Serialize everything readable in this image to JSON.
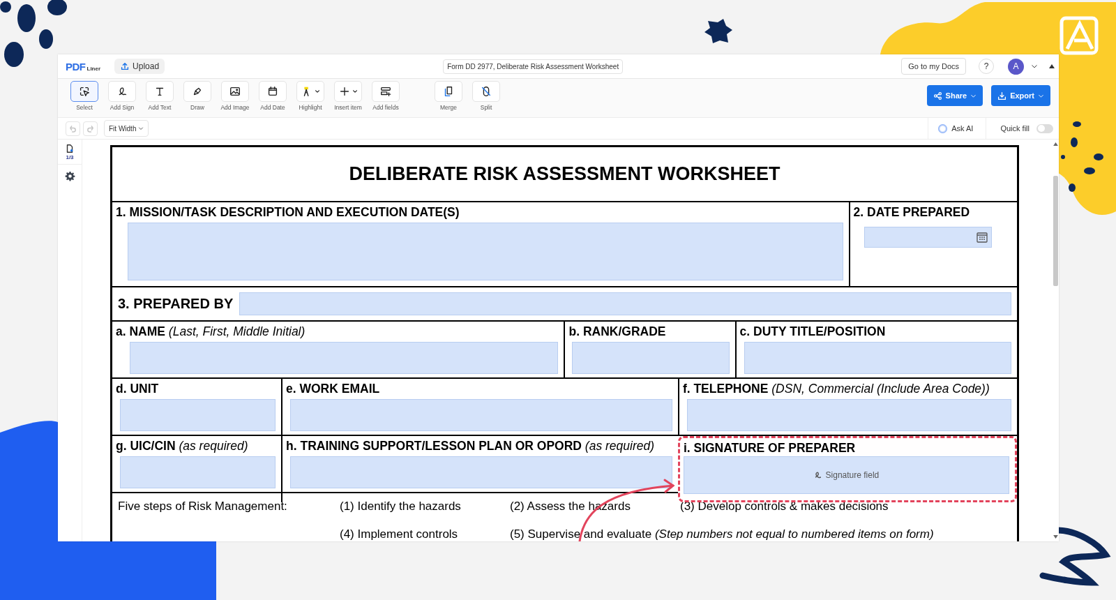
{
  "header": {
    "logo_main": "PDF",
    "logo_sub": "Liner",
    "upload": "Upload",
    "document_title": "Form DD 2977, Deliberate Risk Assessment Worksheet",
    "docs_button": "Go to my Docs",
    "help": "?",
    "avatar": "A"
  },
  "toolbar": {
    "tools": [
      {
        "label": "Select",
        "selected": true,
        "dropdown": false
      },
      {
        "label": "Add Sign",
        "selected": false,
        "dropdown": false
      },
      {
        "label": "Add Text",
        "selected": false,
        "dropdown": false
      },
      {
        "label": "Draw",
        "selected": false,
        "dropdown": false
      },
      {
        "label": "Add Image",
        "selected": false,
        "dropdown": false
      },
      {
        "label": "Add Date",
        "selected": false,
        "dropdown": false
      },
      {
        "label": "Highlight",
        "selected": false,
        "dropdown": true
      },
      {
        "label": "Insert item",
        "selected": false,
        "dropdown": true
      },
      {
        "label": "Add fields",
        "selected": false,
        "dropdown": false
      }
    ],
    "page_tools": [
      {
        "label": "Merge"
      },
      {
        "label": "Split"
      }
    ],
    "share": "Share",
    "export": "Export"
  },
  "subbar": {
    "undo": {
      "disabled": true
    },
    "redo": {
      "disabled": true
    },
    "zoom": "Fit Width",
    "ask_ai": "Ask AI",
    "quick_fill": {
      "label": "Quick fill",
      "on": false
    }
  },
  "sidebar": {
    "page_count": "1/3"
  },
  "form": {
    "title": "DELIBERATE RISK ASSESSMENT WORKSHEET",
    "mission": {
      "label": "1. MISSION/TASK DESCRIPTION AND EXECUTION DATE(S)"
    },
    "date": {
      "label": "2. DATE PREPARED"
    },
    "prepared_by": {
      "label": "3. PREPARED BY"
    },
    "rows": [
      {
        "cells": [
          {
            "label": "a. NAME",
            "note": "(Last, First, Middle Initial)",
            "kind": "text",
            "highlighted": false
          },
          {
            "label": "b. RANK/GRADE",
            "kind": "text",
            "highlighted": false
          },
          {
            "label": "c. DUTY TITLE/POSITION",
            "kind": "text",
            "highlighted": false
          }
        ]
      },
      {
        "cells": [
          {
            "label": "d. UNIT",
            "kind": "text",
            "highlighted": false
          },
          {
            "label": "e. WORK EMAIL",
            "kind": "text",
            "highlighted": false
          },
          {
            "label": "f. TELEPHONE",
            "note": "(DSN, Commercial (Include Area Code))",
            "kind": "text",
            "highlighted": false
          }
        ]
      },
      {
        "cells": [
          {
            "label": "g. UIC/CIN",
            "note": "(as required)",
            "kind": "text",
            "highlighted": false
          },
          {
            "label": "h. TRAINING SUPPORT/LESSON PLAN OR OPORD",
            "note": "(as required)",
            "kind": "text",
            "highlighted": false
          },
          {
            "label": "i. SIGNATURE OF PREPARER",
            "kind": "signature",
            "placeholder": "Signature field",
            "highlighted": true
          }
        ]
      }
    ],
    "steps": {
      "title": "Five steps of Risk Management:",
      "items": [
        "(1) Identify the hazards",
        "(2) Assess the hazards",
        "(3) Develop controls & makes decisions",
        "(4) Implement controls",
        "(5) Supervise and evaluate *(Step numbers not equal to numbered items on form)*"
      ]
    }
  }
}
